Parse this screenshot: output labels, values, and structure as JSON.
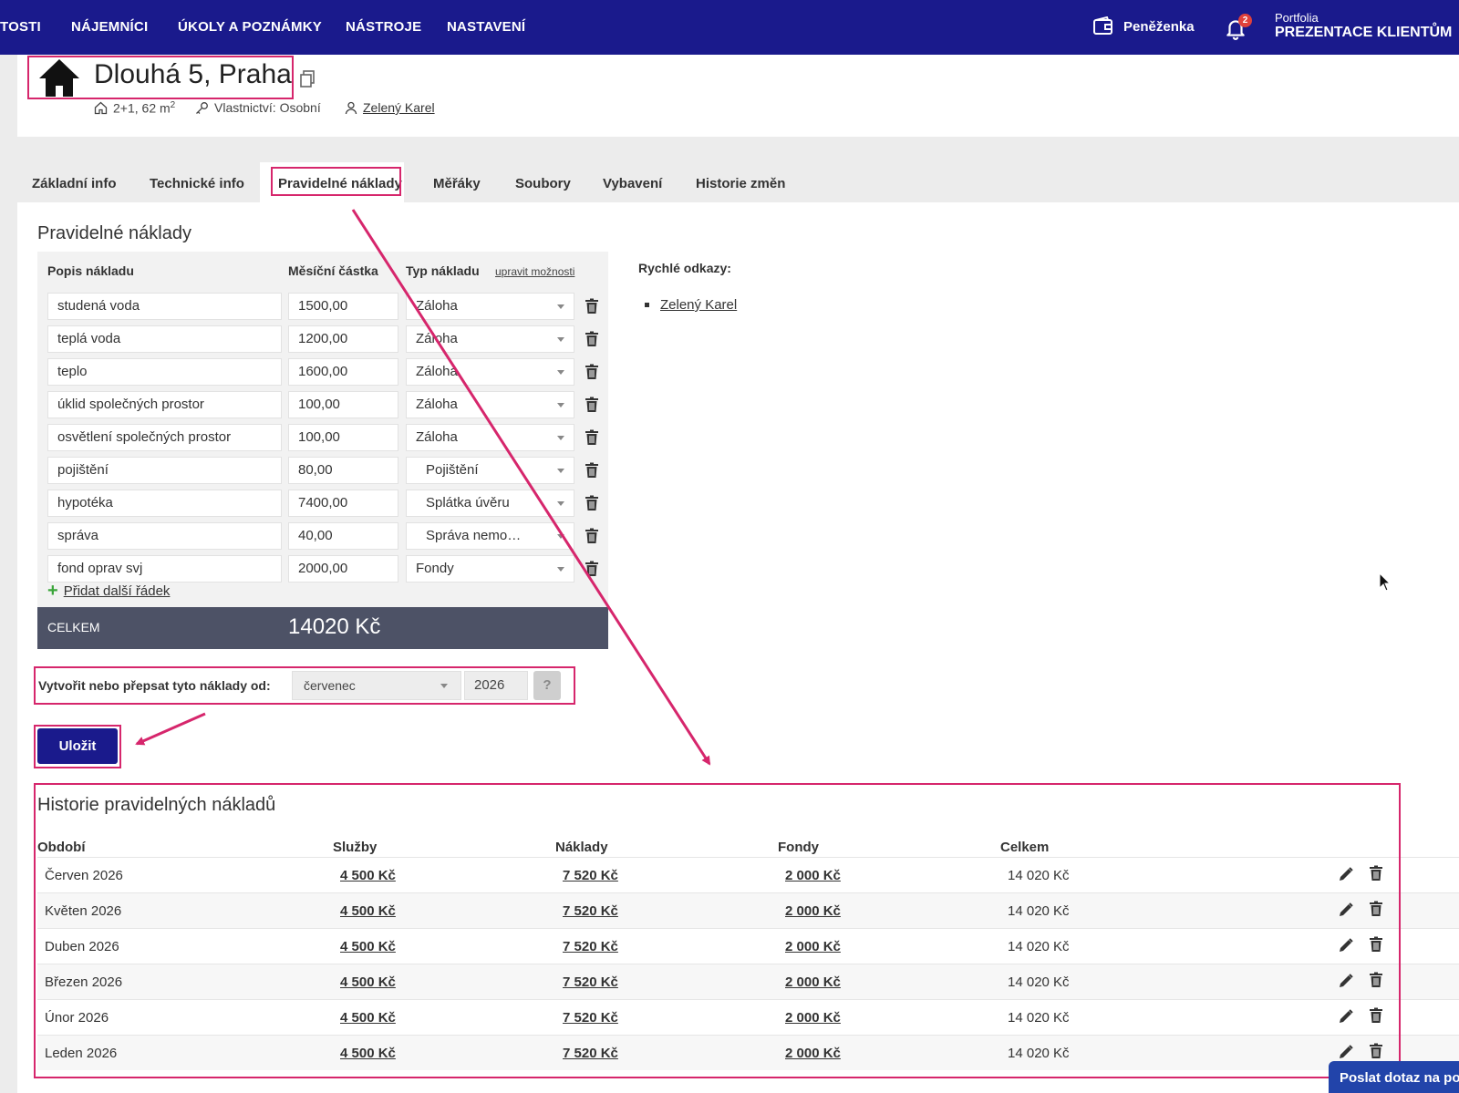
{
  "nav": {
    "items": [
      "TOSTI",
      "NÁJEMNÍCI",
      "ÚKOLY A POZNÁMKY",
      "NÁSTROJE",
      "NASTAVENÍ"
    ],
    "wallet_label": "Peněženka",
    "notification_count": "2",
    "portfolio_small": "Portfolia",
    "portfolio_big": "PREZENTACE KLIENTŮM",
    "color_bg": "#1a1a8c"
  },
  "property": {
    "title": "Dlouhá 5, Praha",
    "layout_text": "2+1, 62 m",
    "layout_sup": "2",
    "ownership": "Vlastnictví: Osobní",
    "owner": "Zelený Karel"
  },
  "tabs": [
    "Základní info",
    "Technické info",
    "Pravidelné náklady",
    "Měřáky",
    "Soubory",
    "Vybavení",
    "Historie změn"
  ],
  "costs": {
    "section_title": "Pravidelné náklady",
    "headers": {
      "description": "Popis nákladu",
      "amount": "Měsíční částka",
      "type": "Typ nákladu",
      "edit_options": "upravit možnosti"
    },
    "rows": [
      {
        "description": "studená voda",
        "amount": "1500,00",
        "type": "Záloha"
      },
      {
        "description": "teplá voda",
        "amount": "1200,00",
        "type": "Záloha"
      },
      {
        "description": "teplo",
        "amount": "1600,00",
        "type": "Záloha"
      },
      {
        "description": "úklid společných prostor",
        "amount": "100,00",
        "type": "Záloha"
      },
      {
        "description": "osvětlení společných prostor",
        "amount": "100,00",
        "type": "Záloha"
      },
      {
        "description": "pojištění",
        "amount": "80,00",
        "type": "Pojištění"
      },
      {
        "description": "hypotéka",
        "amount": "7400,00",
        "type": "Splátka úvěru"
      },
      {
        "description": "správa",
        "amount": "40,00",
        "type": "Správa nemo…"
      },
      {
        "description": "fond oprav svj",
        "amount": "2000,00",
        "type": "Fondy"
      }
    ],
    "add_row_label": "Přidat další řádek",
    "total_label": "CELKEM",
    "total_value": "14020 Kč",
    "from_label": "Vytvořit nebo přepsat tyto náklady od:",
    "from_month": "červenec",
    "from_year": "2026",
    "help": "?",
    "save_label": "Uložit"
  },
  "quick_links": {
    "title": "Rychlé odkazy:",
    "items": [
      "Zelený Karel"
    ]
  },
  "history": {
    "title": "Historie pravidelných nákladů",
    "headers": {
      "period": "Období",
      "services": "Služby",
      "costs": "Náklady",
      "funds": "Fondy",
      "total": "Celkem"
    },
    "rows": [
      {
        "period": "Červen 2026",
        "services": "4 500 Kč",
        "costs": "7 520 Kč",
        "funds": "2 000 Kč",
        "total": "14 020 Kč"
      },
      {
        "period": "Květen 2026",
        "services": "4 500 Kč",
        "costs": "7 520 Kč",
        "funds": "2 000 Kč",
        "total": "14 020 Kč"
      },
      {
        "period": "Duben 2026",
        "services": "4 500 Kč",
        "costs": "7 520 Kč",
        "funds": "2 000 Kč",
        "total": "14 020 Kč"
      },
      {
        "period": "Březen 2026",
        "services": "4 500 Kč",
        "costs": "7 520 Kč",
        "funds": "2 000 Kč",
        "total": "14 020 Kč"
      },
      {
        "period": "Únor 2026",
        "services": "4 500 Kč",
        "costs": "7 520 Kč",
        "funds": "2 000 Kč",
        "total": "14 020 Kč"
      },
      {
        "period": "Leden 2026",
        "services": "4 500 Kč",
        "costs": "7 520 Kč",
        "funds": "2 000 Kč",
        "total": "14 020 Kč"
      }
    ]
  },
  "chat_label": "Poslat dotaz na podporu",
  "annotation_color": "#d6266c"
}
